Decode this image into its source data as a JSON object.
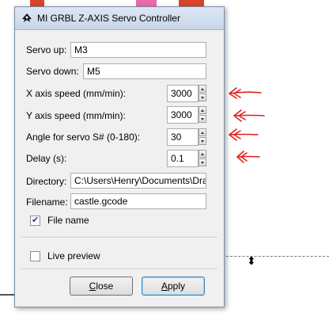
{
  "dialog": {
    "title": "MI GRBL Z-AXIS Servo Controller"
  },
  "fields": {
    "servo_up": {
      "label": "Servo up:",
      "value": "M3"
    },
    "servo_down": {
      "label": "Servo down:",
      "value": "M5"
    },
    "x_speed": {
      "label": "X axis speed (mm/min):",
      "value": "3000"
    },
    "y_speed": {
      "label": "Y axis speed (mm/min):",
      "value": "3000"
    },
    "servo_angle": {
      "label": "Angle for servo S# (0-180):",
      "value": "30"
    },
    "delay": {
      "label": "Delay (s):",
      "value": "0.1"
    },
    "directory": {
      "label": "Directory:",
      "value": "C:\\Users\\Henry\\Documents\\Dra"
    },
    "filename": {
      "label": "Filename:",
      "value": "castle.gcode"
    }
  },
  "checkboxes": {
    "file_name": {
      "label": "File name",
      "checked": true
    },
    "live_preview": {
      "label": "Live preview",
      "checked": false
    }
  },
  "buttons": {
    "close": {
      "mnemonic": "C",
      "rest": "lose"
    },
    "apply": {
      "mnemonic": "A",
      "rest": "pply"
    }
  },
  "colors": {
    "annotation_red": "#e0201f",
    "canvas_pink": "#e86aa8",
    "canvas_red": "#d8452a"
  },
  "icons": {
    "app": "inkscape-icon",
    "annotation": "red-arrow-icon",
    "canvas_handle": "vertical-resize-handle-icon"
  }
}
